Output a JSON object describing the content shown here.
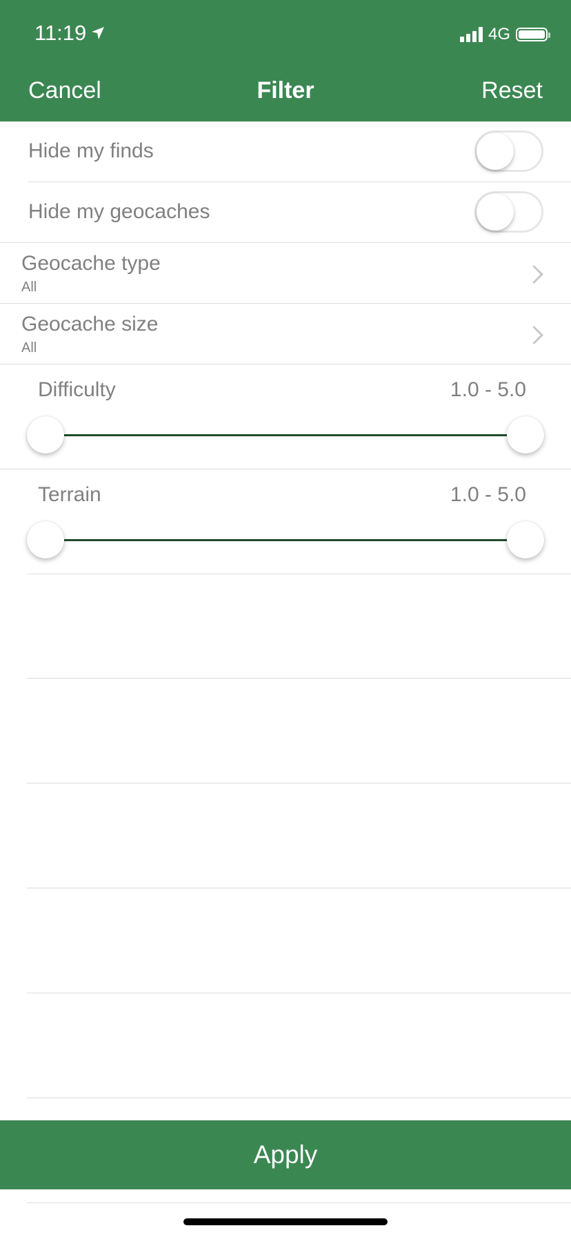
{
  "status_bar": {
    "time": "11:19",
    "network": "4G",
    "icons": [
      "location-arrow-icon",
      "signal-icon",
      "battery-icon"
    ]
  },
  "nav": {
    "cancel_label": "Cancel",
    "title": "Filter",
    "reset_label": "Reset"
  },
  "filters": {
    "hide_my_finds": {
      "label": "Hide my finds",
      "enabled": false
    },
    "hide_my_geocaches": {
      "label": "Hide my geocaches",
      "enabled": false
    },
    "geocache_type": {
      "label": "Geocache type",
      "value": "All"
    },
    "geocache_size": {
      "label": "Geocache size",
      "value": "All"
    },
    "difficulty": {
      "label": "Difficulty",
      "range_text": "1.0 - 5.0",
      "min": 1.0,
      "max": 5.0
    },
    "terrain": {
      "label": "Terrain",
      "range_text": "1.0 - 5.0",
      "min": 1.0,
      "max": 5.0
    }
  },
  "apply_label": "Apply",
  "colors": {
    "brand_green": "#3b8752",
    "slider_track": "#1e4d2b",
    "text_gray": "#808080"
  }
}
